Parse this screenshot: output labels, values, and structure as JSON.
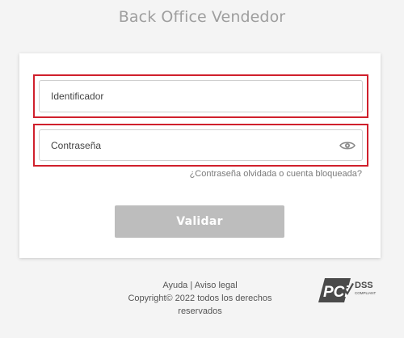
{
  "page": {
    "title": "Back Office Vendedor"
  },
  "login_form": {
    "username_placeholder": "Identificador",
    "username_value": "",
    "password_placeholder": "Contraseña",
    "password_value": "",
    "show_password_icon": "eye-icon",
    "forgot_link": "¿Contraseña olvidada o cuenta bloqueada?",
    "submit_label": "Validar",
    "highlight_color": "#d0202c"
  },
  "footer": {
    "help_link": "Ayuda",
    "separator": "|",
    "legal_link": "Aviso legal",
    "copyright": "Copyright© 2022 todos los derechos reservados"
  },
  "badge": {
    "pci_text": "PCi",
    "dss_text": "DSS",
    "compliant_text": "COMPLIANT"
  }
}
